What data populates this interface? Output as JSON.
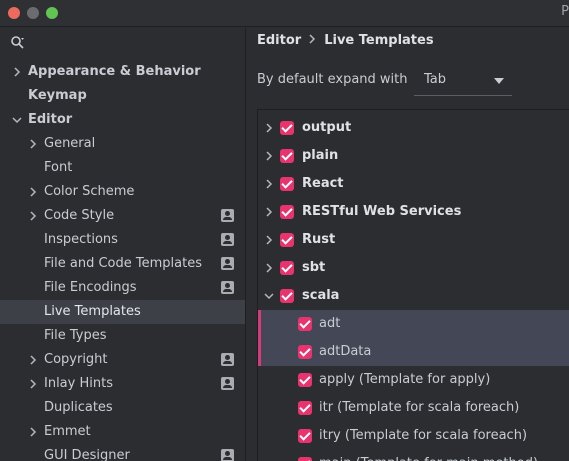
{
  "window": {
    "title": "P"
  },
  "search": {
    "placeholder": ""
  },
  "sidebar": {
    "items": [
      {
        "label": "Appearance & Behavior"
      },
      {
        "label": "Keymap"
      },
      {
        "label": "Editor"
      },
      {
        "label": "General"
      },
      {
        "label": "Font"
      },
      {
        "label": "Color Scheme"
      },
      {
        "label": "Code Style"
      },
      {
        "label": "Inspections"
      },
      {
        "label": "File and Code Templates"
      },
      {
        "label": "File Encodings"
      },
      {
        "label": "Live Templates"
      },
      {
        "label": "File Types"
      },
      {
        "label": "Copyright"
      },
      {
        "label": "Inlay Hints"
      },
      {
        "label": "Duplicates"
      },
      {
        "label": "Emmet"
      },
      {
        "label": "GUI Designer"
      }
    ]
  },
  "breadcrumb": {
    "parent": "Editor",
    "current": "Live Templates"
  },
  "expand": {
    "label": "By default expand with",
    "value": "Tab"
  },
  "templates": {
    "rows": [
      {
        "label": "output"
      },
      {
        "label": "plain"
      },
      {
        "label": "React"
      },
      {
        "label": "RESTful Web Services"
      },
      {
        "label": "Rust"
      },
      {
        "label": "sbt"
      },
      {
        "label": "scala"
      },
      {
        "label": "adt"
      },
      {
        "label": "adtData"
      },
      {
        "label": "apply (Template for apply)"
      },
      {
        "label": "itr (Template for scala foreach)"
      },
      {
        "label": "itry (Template for scala foreach)"
      },
      {
        "label": "main (Template for main method)"
      }
    ]
  },
  "colors": {
    "accent_checkbox": "#e8336e",
    "selection": "#434756",
    "sidebar_selection": "#3d4047"
  }
}
